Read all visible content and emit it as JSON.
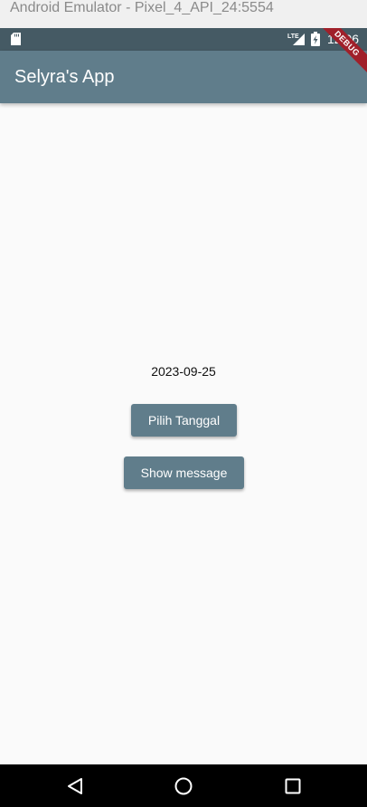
{
  "window": {
    "title": "Android Emulator - Pixel_4_API_24:5554"
  },
  "status_bar": {
    "time": "12:06",
    "network_label": "LTE",
    "icons": [
      "sd-card-icon",
      "lte-signal-icon",
      "battery-charging-icon"
    ],
    "color": "#455a64"
  },
  "app_bar": {
    "title": "Selyra's App",
    "color": "#607d8b"
  },
  "debug_banner": {
    "label": "DEBUG",
    "color": "#a0202a"
  },
  "main": {
    "date_value": "2023-09-25",
    "pick_date_label": "Pilih Tanggal",
    "show_message_label": "Show message",
    "button_color": "#607d8b",
    "background": "#fafafa"
  },
  "nav_bar": {
    "buttons": [
      "back-icon",
      "home-icon",
      "recent-apps-icon"
    ]
  }
}
